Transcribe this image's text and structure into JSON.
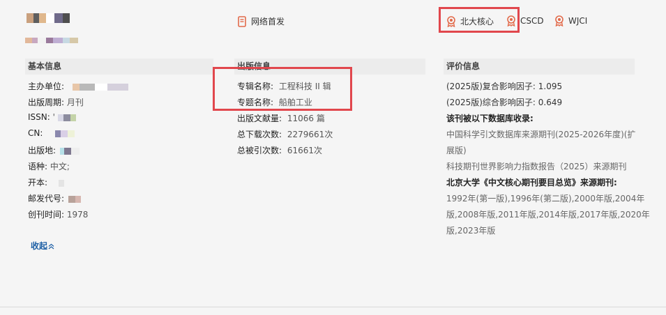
{
  "header": {
    "network_first": "网络首发",
    "badges": [
      {
        "icon": "award-icon",
        "label": "北大核心"
      },
      {
        "icon": "award-icon",
        "label": "CSCD"
      },
      {
        "icon": "award-icon",
        "label": "WJCI"
      }
    ]
  },
  "basic": {
    "title": "基本信息",
    "rows": [
      {
        "label": "主办单位:",
        "value": ""
      },
      {
        "label": "出版周期:",
        "value": "月刊"
      },
      {
        "label": "ISSN:",
        "value": "'"
      },
      {
        "label": "CN:",
        "value": ""
      },
      {
        "label": "出版地:",
        "value": ""
      },
      {
        "label": "语种:",
        "value": "中文;"
      },
      {
        "label": "开本:",
        "value": ""
      },
      {
        "label": "邮发代号:",
        "value": ""
      },
      {
        "label": "创刊时间:",
        "value": "1978"
      }
    ]
  },
  "publish": {
    "title": "出版信息",
    "rows": [
      {
        "label": "专辑名称:",
        "value": "工程科技 II 辑"
      },
      {
        "label": "专题名称:",
        "value": "船舶工业"
      },
      {
        "label": "出版文献量:",
        "value": "11066 篇"
      },
      {
        "label": "总下载次数:",
        "value": "2279661次"
      },
      {
        "label": "总被引次数:",
        "value": "61661次"
      }
    ]
  },
  "evaluation": {
    "title": "评价信息",
    "composite_if": "(2025版)复合影响因子: 1.095",
    "comprehensive_if": "(2025版)综合影响因子: 0.649",
    "db_heading": "该刊被以下数据库收录:",
    "cscd_line1": "中国科学引文数据库来源期刊(2025-2026年度)(扩",
    "cscd_line2": "展版)",
    "wjci_line": "科技期刊世界影响力指数报告（2025）来源期刊",
    "pku_heading": "北京大学《中文核心期刊要目总览》来源期刊:",
    "pku_line1": "1992年(第一版),1996年(第二版),2000年版,2004年",
    "pku_line2": "版,2008年版,2011年版,2014年版,2017年版,2020年",
    "pku_line3": "版,2023年版"
  },
  "collapse_label": "收起",
  "colors": {
    "accent_red": "#e1474d",
    "link_blue": "#1d5fa5",
    "badge_orange": "#e26a4a"
  }
}
